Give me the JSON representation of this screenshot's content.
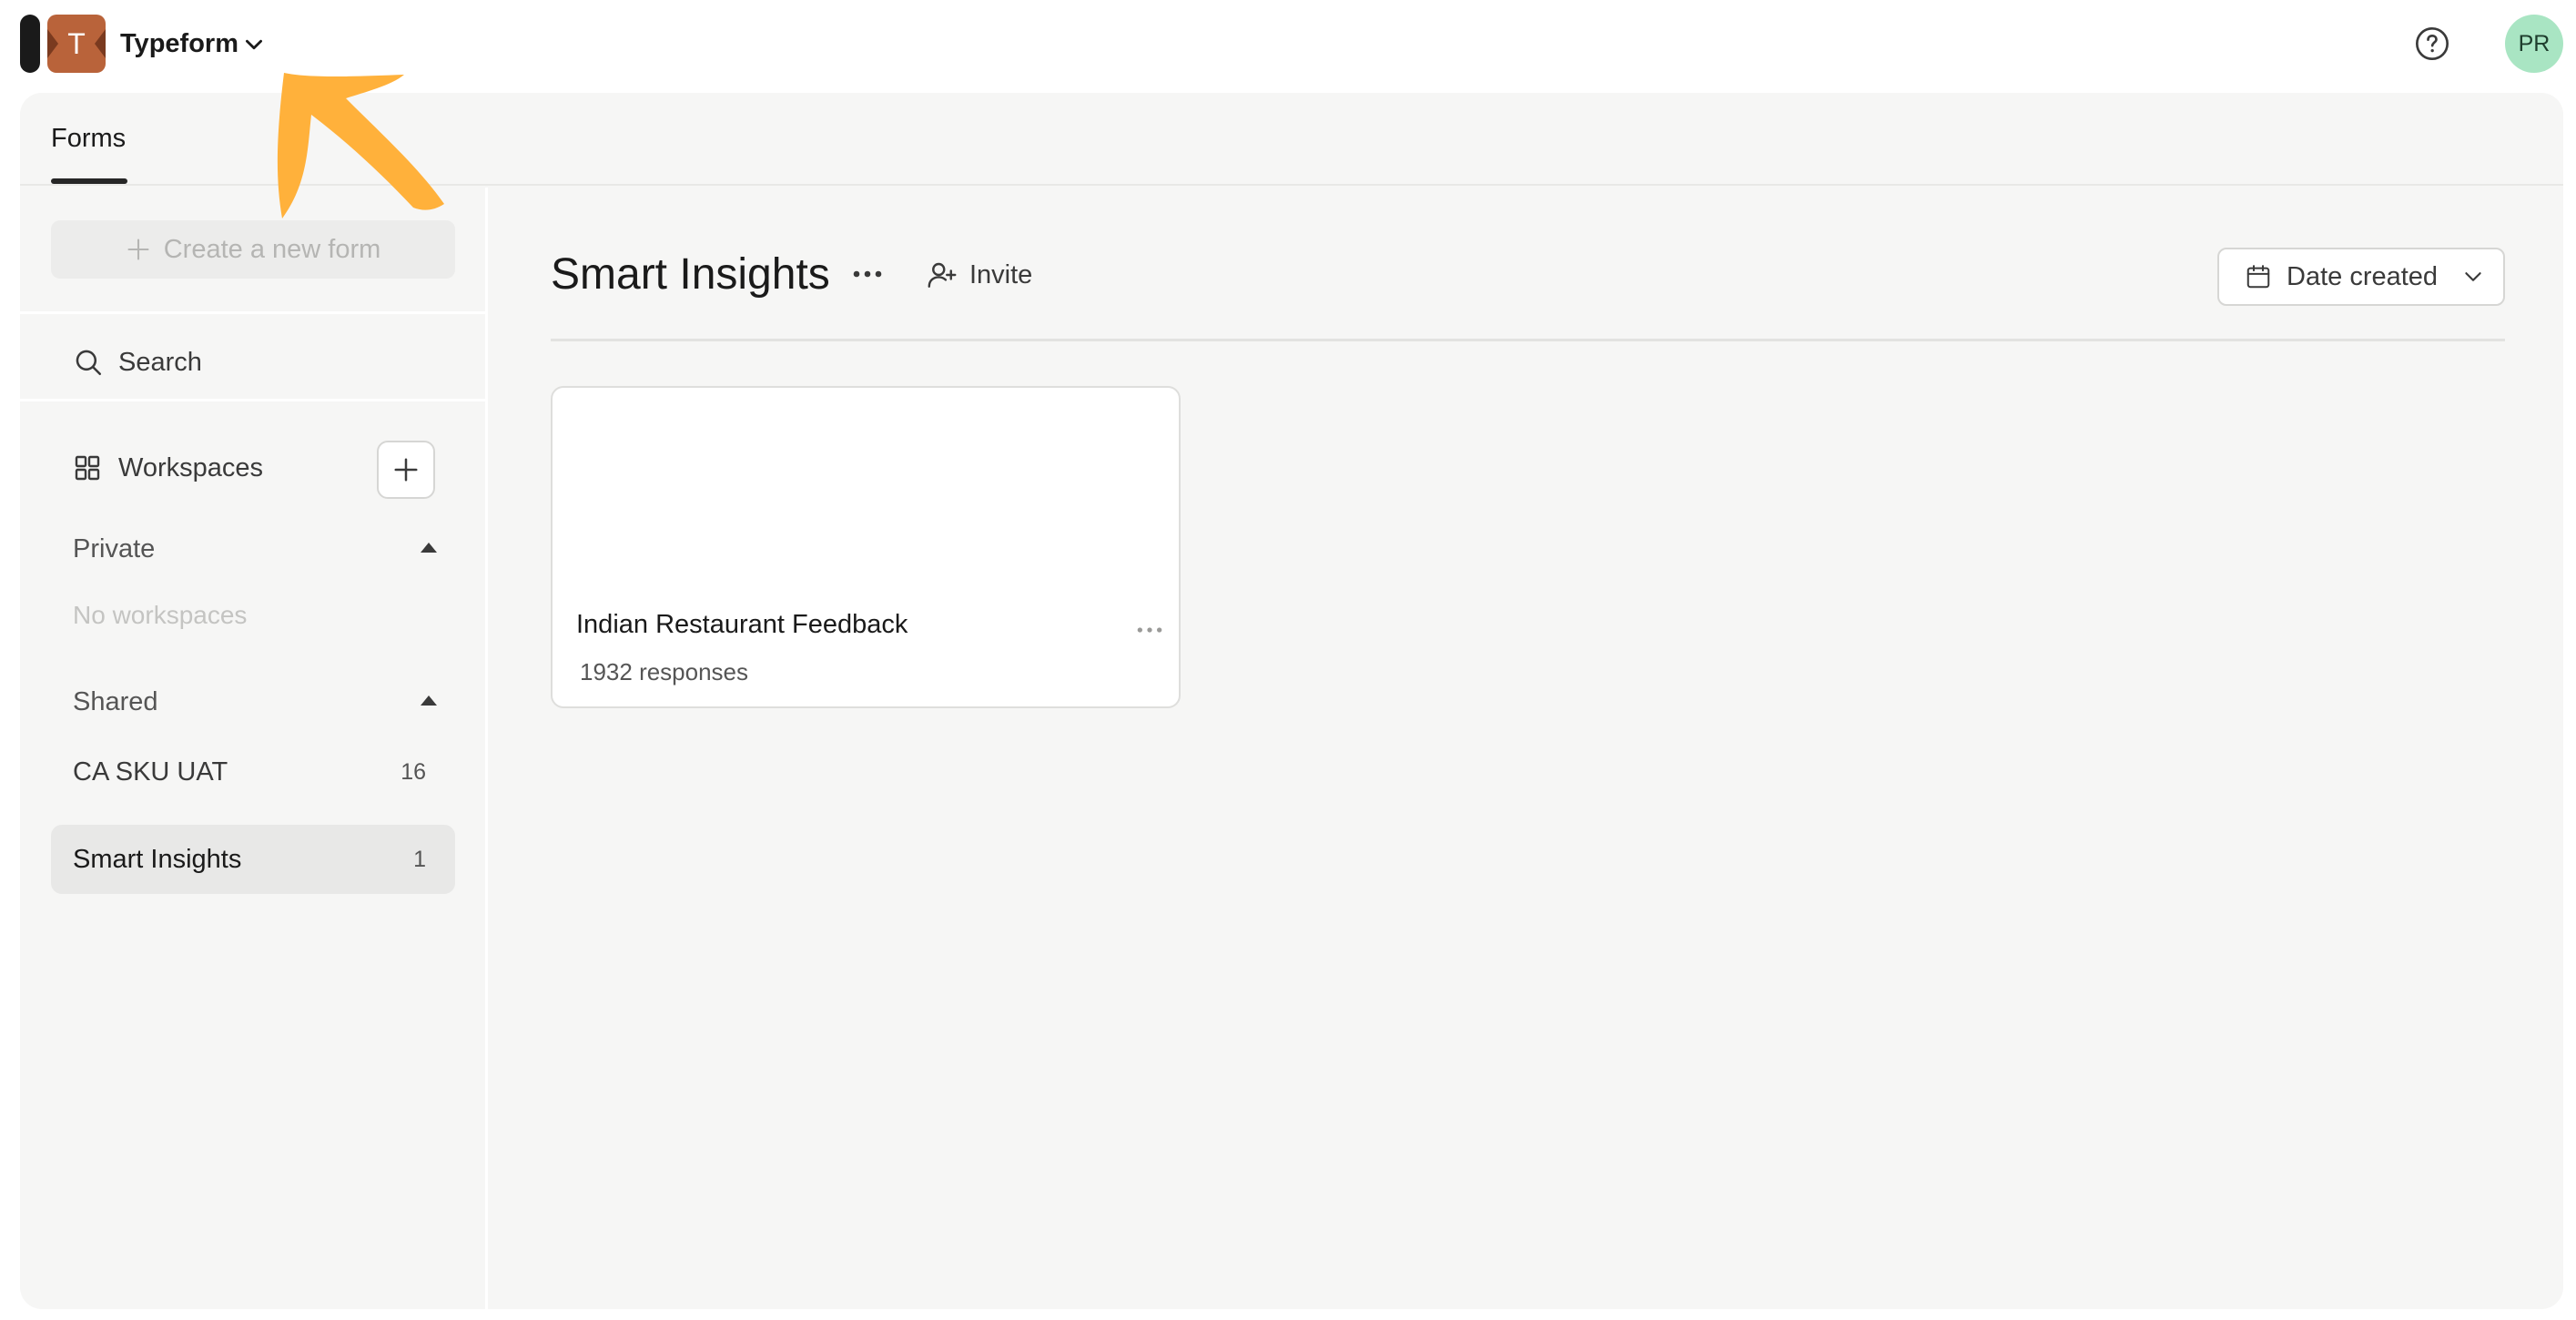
{
  "topbar": {
    "brand_letter": "T",
    "account_name": "Typeform",
    "avatar_initials": "PR",
    "avatar_color": "#a9e5c3",
    "icons": [
      "brand-logo",
      "chevron-down-icon",
      "help-circle-icon"
    ]
  },
  "tabs": [
    {
      "label": "Forms",
      "active": true
    }
  ],
  "sidebar": {
    "create_label": "Create a new form",
    "search_label": "Search",
    "workspaces_label": "Workspaces",
    "private": {
      "label": "Private",
      "empty_text": "No workspaces"
    },
    "shared": {
      "label": "Shared",
      "items": [
        {
          "name": "CA SKU UAT",
          "count": "16",
          "active": false
        },
        {
          "name": "Smart Insights",
          "count": "1",
          "active": true
        }
      ]
    }
  },
  "main": {
    "workspace_title": "Smart Insights",
    "invite_label": "Invite",
    "sort_label": "Date created",
    "forms": [
      {
        "title": "Indian Restaurant Feedback",
        "responses": "1932 responses"
      }
    ]
  },
  "colors": {
    "accent_arrow": "#ffb13b",
    "brand_logo": "#b9633a",
    "frame_bg": "#f6f6f5"
  }
}
